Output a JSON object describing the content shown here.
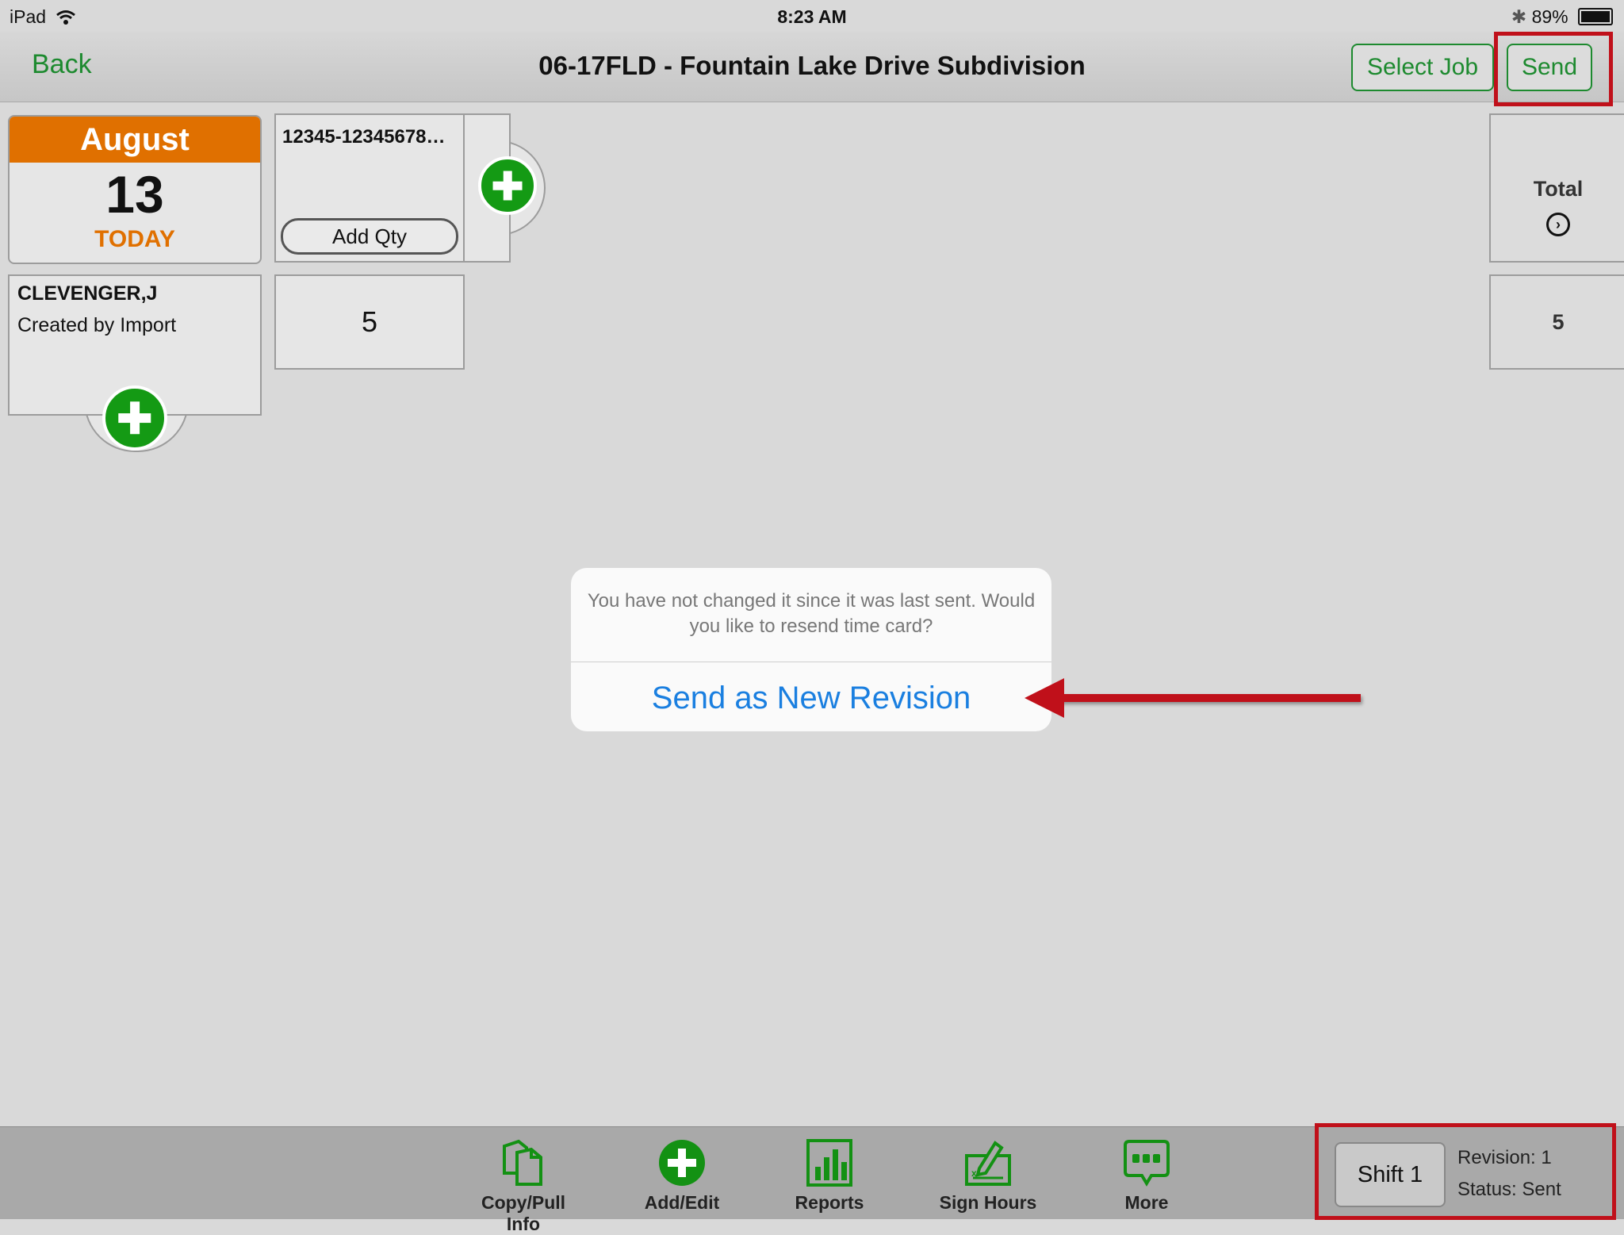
{
  "status_bar": {
    "device": "iPad",
    "time": "8:23 AM",
    "battery": "89%",
    "battery_level": 0.89
  },
  "nav": {
    "back": "Back",
    "title": "06-17FLD - Fountain Lake Drive Subdivision",
    "select_job": "Select Job",
    "send": "Send"
  },
  "date_card": {
    "month": "August",
    "day": "13",
    "label": "TODAY"
  },
  "item_column": {
    "code": "12345-12345678…",
    "add_qty": "Add Qty"
  },
  "employee": {
    "name": "CLEVENGER,J",
    "note": "Created by Import",
    "value": "5"
  },
  "total": {
    "label": "Total",
    "value": "5"
  },
  "alert": {
    "message": "You have not changed it since it was last sent.  Would you like to resend time card?",
    "action": "Send as New Revision"
  },
  "toolbar": {
    "items": [
      {
        "label": "Copy/Pull Info",
        "icon": "copy-icon"
      },
      {
        "label": "Add/Edit",
        "icon": "plus-circle-icon"
      },
      {
        "label": "Reports",
        "icon": "bar-chart-icon"
      },
      {
        "label": "Sign Hours",
        "icon": "signature-icon"
      },
      {
        "label": "More",
        "icon": "chat-bubble-icon"
      }
    ],
    "shift": "Shift 1",
    "revision": "Revision: 1",
    "status": "Status: Sent"
  },
  "colors": {
    "accent_green": "#1d8a2f",
    "orange": "#e07000",
    "annotation_red": "#c0101a",
    "link_blue": "#1a7fe0"
  }
}
